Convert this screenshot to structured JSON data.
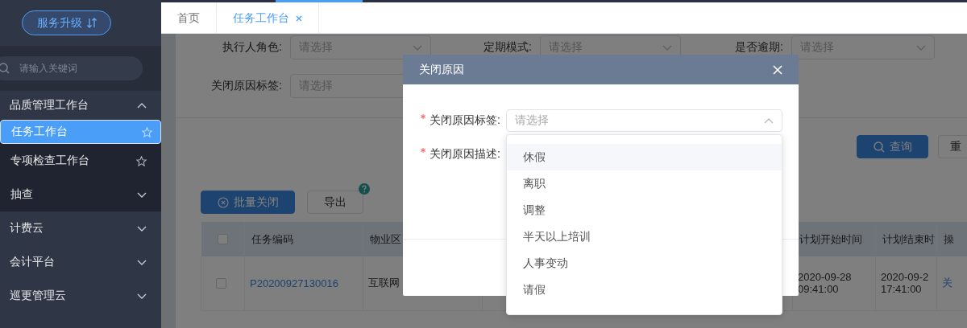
{
  "sidebar": {
    "upgrade_button": "服务升级",
    "search": {
      "placeholder": "请输入关键词"
    },
    "menu": [
      {
        "label": "品质管理工作台",
        "expanded": true,
        "children": [
          {
            "label": "任务工作台",
            "selected": true
          },
          {
            "label": "专项检查工作台",
            "selected": false
          },
          {
            "label": "抽查",
            "expanded": false
          }
        ]
      },
      {
        "label": "计费云",
        "expanded": false
      },
      {
        "label": "会计平台",
        "expanded": false
      },
      {
        "label": "巡更管理云",
        "expanded": false
      }
    ]
  },
  "tabs": [
    {
      "label": "首页",
      "selected": false,
      "closable": false
    },
    {
      "label": "任务工作台",
      "selected": true,
      "closable": true
    }
  ],
  "filters": [
    {
      "label": "执行人角色:",
      "placeholder": "请选择"
    },
    {
      "label": "定期模式:",
      "placeholder": "请选择"
    },
    {
      "label": "是否逾期:",
      "placeholder": "请选择"
    },
    {
      "label": "关闭原因标签:",
      "placeholder": "请选择"
    }
  ],
  "search_buttons": [
    {
      "label": "查询",
      "kind": "primary"
    },
    {
      "label": "重",
      "kind": "default"
    }
  ],
  "toolbar": [
    {
      "label": "批量关闭",
      "kind": "primary"
    },
    {
      "label": "导出",
      "kind": "help"
    }
  ],
  "table": {
    "all_checked": false,
    "columns": [
      {
        "kind": "check"
      },
      {
        "label": "任务编码"
      },
      {
        "label": "物业区"
      },
      {
        "kind": "blank"
      },
      {
        "kind": "blank"
      },
      {
        "kind": "blank"
      },
      {
        "label": "计划开始时间"
      },
      {
        "label": "计划结束时"
      },
      {
        "label": "操"
      }
    ],
    "rows": [
      {
        "checked": false,
        "cells": [
          "",
          "P20200927130016",
          "互联网",
          "",
          "",
          "",
          "2020-09-28\n09:41:00",
          "2020-09-2\n17:41:00",
          "关"
        ]
      }
    ]
  },
  "modal": {
    "title": "关闭原因",
    "fields": [
      {
        "label": "关闭原因标签:",
        "required": true,
        "placeholder": "请选择",
        "open": true
      },
      {
        "label": "关闭原因描述:",
        "required": true
      }
    ],
    "options": [
      {
        "label": "休假",
        "hovered": true
      },
      {
        "label": "离职",
        "hovered": false
      },
      {
        "label": "调整",
        "hovered": false
      },
      {
        "label": "半天以上培训",
        "hovered": false
      },
      {
        "label": "人事变动",
        "hovered": false
      },
      {
        "label": "请假",
        "hovered": false
      }
    ]
  }
}
